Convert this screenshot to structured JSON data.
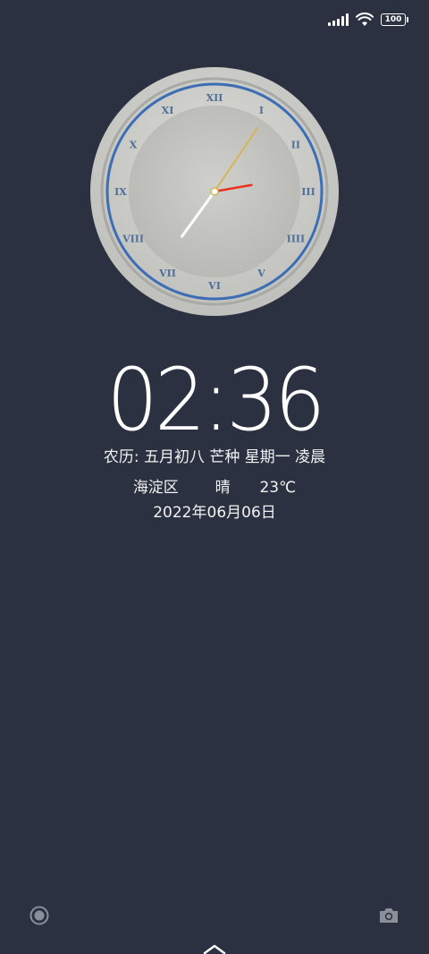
{
  "status_bar": {
    "battery_level": "100",
    "icons": [
      "signal-icon",
      "wifi-icon",
      "battery-icon"
    ]
  },
  "analog_clock": {
    "numerals": [
      "XII",
      "I",
      "II",
      "III",
      "IIII",
      "V",
      "VI",
      "VII",
      "VIII",
      "IX",
      "X",
      "XI"
    ],
    "hour": 2,
    "minute": 36
  },
  "time": "02:36",
  "lunar_line": "农历: 五月初八 芒种  星期一  凌晨",
  "weather": {
    "district": "海淀区",
    "condition": "晴",
    "temperature": "23℃"
  },
  "date": "2022年06月06日",
  "bottom": {
    "left_icon": "record-icon",
    "right_icon": "camera-icon",
    "center_icon": "chevron-up-icon"
  },
  "colors": {
    "background": "#2b3140",
    "clock_ring": "#3d6eb5",
    "second_hand": "#e8321e",
    "minute_hand": "#d6b45a"
  }
}
